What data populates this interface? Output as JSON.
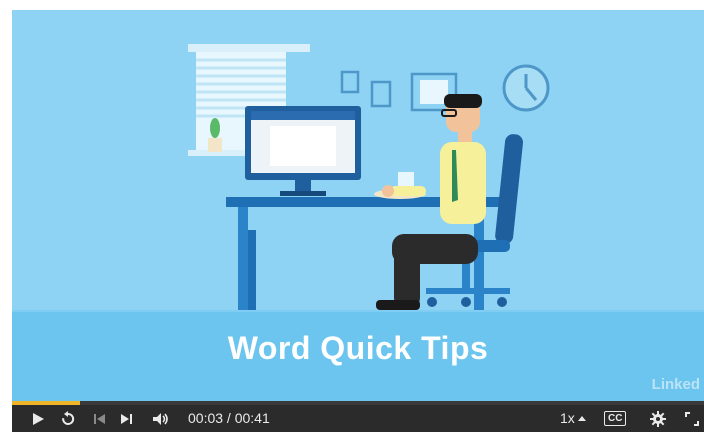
{
  "video": {
    "title": "Word Quick Tips",
    "watermark": "Linked",
    "progress_fraction": 0.098
  },
  "controls": {
    "time_display": "00:03 / 00:41",
    "speed": "1x",
    "cc_label": "CC"
  },
  "icons": [
    "play-icon",
    "replay-icon",
    "skip-back-icon",
    "skip-forward-icon",
    "volume-icon",
    "speed-caret-icon",
    "captions-icon",
    "gear-icon",
    "fullscreen-icon"
  ],
  "colors": {
    "sky": "#8fd3f4",
    "band": "#6cc5ef",
    "accent": "#f0b429",
    "bar": "#2b2b2b"
  }
}
